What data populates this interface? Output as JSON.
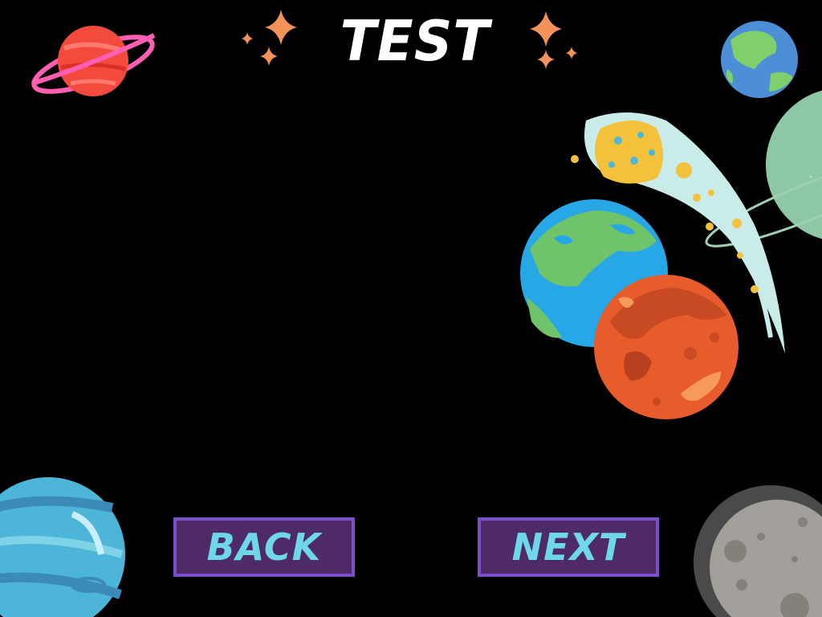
{
  "screen": {
    "title": "TEST",
    "background_color": "#000000"
  },
  "buttons": {
    "back_label": "BACK",
    "next_label": "NEXT",
    "fill_color": "#4e2a66",
    "border_color": "#7a4fc9",
    "text_color": "#6fd7ea"
  },
  "decorations": [
    "ringed-planet-icon",
    "sparkle-cluster-icon",
    "earth-icon",
    "comet-icon",
    "mars-icon",
    "neptune-icon",
    "moon-icon"
  ]
}
